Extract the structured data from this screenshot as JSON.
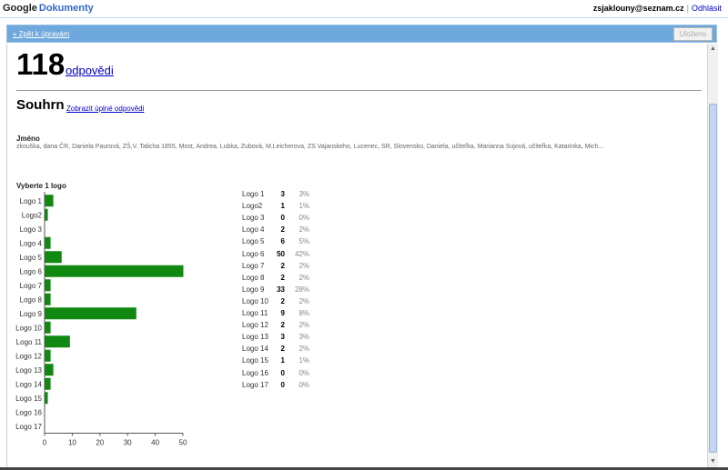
{
  "header": {
    "logo_google": "Google",
    "product": "Dokumenty",
    "email": "zsjaklouny@seznam.cz",
    "separator": "|",
    "logout": "Odhlásit"
  },
  "toolbar": {
    "back_link": "« Zpět k úpravám",
    "saved_button": "Uloženo"
  },
  "summary": {
    "response_count": "118",
    "response_label": "odpovědi",
    "title": "Souhrn",
    "full_responses_link": "Zobrazit úplné odpovědi"
  },
  "question_name": {
    "title": "Jméno",
    "answers": "zkouška, dana ČR, Daniela Paurová, ZŠ,V. Talicha 1855, Most, Andrea, Lubka, Zubová, M.Leicherova, ZS Vajanskeho, Lucenec, SR, Slovensko, Daniela, učiteľka, Marianna Sujová, učiteľka, Katarinka, Mich..."
  },
  "question_logo": {
    "title": "Vyberte 1 logo"
  },
  "chart_data": {
    "type": "bar",
    "orientation": "horizontal",
    "categories": [
      "Logo 1",
      "Logo2",
      "Logo 3",
      "Logo 4",
      "Logo 5",
      "Logo 6",
      "Logo 7",
      "Logo 8",
      "Logo 9",
      "Logo 10",
      "Logo 11",
      "Logo 12",
      "Logo 13",
      "Logo 14",
      "Logo 15",
      "Logo 16",
      "Logo 17"
    ],
    "values": [
      3,
      1,
      0,
      2,
      6,
      50,
      2,
      2,
      33,
      2,
      9,
      2,
      3,
      2,
      1,
      0,
      0
    ],
    "percentages": [
      "3%",
      "1%",
      "0%",
      "2%",
      "5%",
      "42%",
      "2%",
      "2%",
      "28%",
      "2%",
      "8%",
      "2%",
      "3%",
      "2%",
      "1%",
      "0%",
      "0%"
    ],
    "xlim": [
      0,
      50
    ],
    "xticks": [
      "0",
      "10",
      "20",
      "30",
      "40",
      "50"
    ],
    "bar_color": "#118811"
  }
}
